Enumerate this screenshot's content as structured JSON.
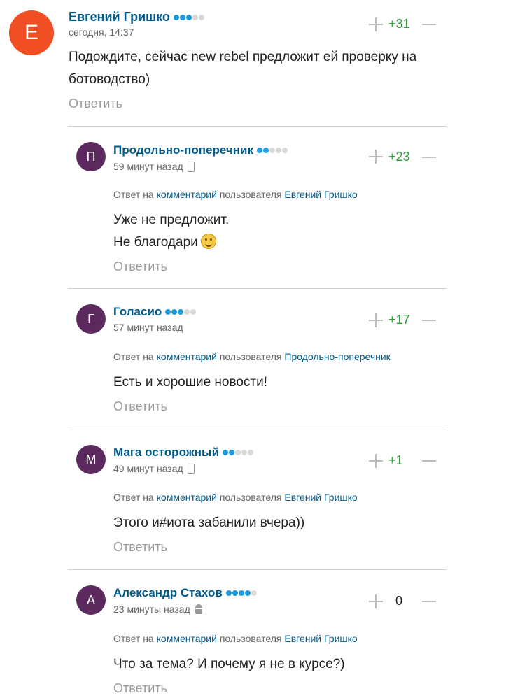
{
  "top_comment": {
    "avatar_letter": "Е",
    "avatar_color": "#f04e23",
    "author": "Евгений Гришко",
    "rating_dots": {
      "filled": 3,
      "total": 5
    },
    "time": "сегодня, 14:37",
    "score": "+31",
    "text_line1": "Подождите, сейчас new rebel предложит ей проверку на",
    "text_line2": "ботоводство)",
    "reply_label": "Ответить"
  },
  "replies": [
    {
      "avatar_letter": "П",
      "avatar_color": "#5c2a5e",
      "author": "Продольно-поперечник",
      "rating_dots": {
        "filled": 2,
        "total": 5
      },
      "time": "59 минут назад",
      "device_icon": "phone-icon",
      "score": "+23",
      "reply_prefix": "Ответ на",
      "reply_link": "комментарий",
      "reply_mid": "пользователя",
      "reply_user": "Евгений Гришко",
      "text_line1": "Уже не предложит.",
      "text_line2": "Не благодари",
      "emoji": "wink-emoji",
      "reply_label": "Ответить"
    },
    {
      "avatar_letter": "Г",
      "avatar_color": "#5c2a5e",
      "author": "Голасио",
      "rating_dots": {
        "filled": 3,
        "total": 5
      },
      "time": "57 минут назад",
      "score": "+17",
      "reply_prefix": "Ответ на",
      "reply_link": "комментарий",
      "reply_mid": "пользователя",
      "reply_user": "Продольно-поперечник",
      "text_line1": "Есть и хорошие новости!",
      "reply_label": "Ответить"
    },
    {
      "avatar_letter": "М",
      "avatar_color": "#5c2a5e",
      "author": "Мага осторожный",
      "rating_dots": {
        "filled": 2,
        "total": 5
      },
      "time": "49 минут назад",
      "device_icon": "phone-icon",
      "score": "+1",
      "reply_prefix": "Ответ на",
      "reply_link": "комментарий",
      "reply_mid": "пользователя",
      "reply_user": "Евгений Гришко",
      "text_line1": "Этого и#иота забанили вчера))",
      "reply_label": "Ответить"
    },
    {
      "avatar_letter": "А",
      "avatar_color": "#5c2a5e",
      "author": "Александр Стахов",
      "rating_dots": {
        "filled": 4,
        "total": 5
      },
      "time": "23 минуты назад",
      "device_icon": "android-icon",
      "score": "0",
      "reply_prefix": "Ответ на",
      "reply_link": "комментарий",
      "reply_mid": "пользователя",
      "reply_user": "Евгений Гришко",
      "text_line1": "Что за тема? И почему я не в курсе?)",
      "reply_label": "Ответить"
    }
  ]
}
